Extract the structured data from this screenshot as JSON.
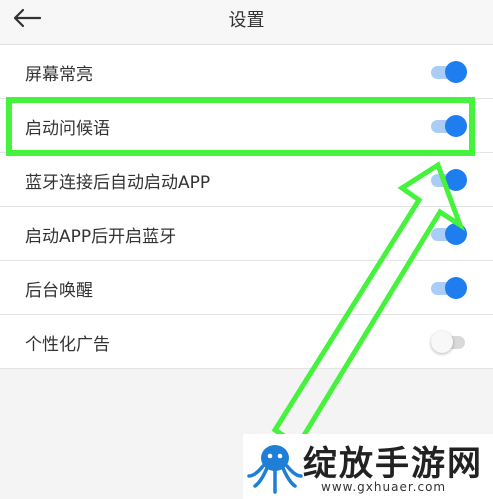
{
  "header": {
    "title": "设置",
    "back_icon": "arrow-left-icon"
  },
  "settings": [
    {
      "label": "屏幕常亮",
      "enabled": true
    },
    {
      "label": "启动问候语",
      "enabled": true
    },
    {
      "label": "蓝牙连接后自动启动APP",
      "enabled": true
    },
    {
      "label": "启动APP后开启蓝牙",
      "enabled": true
    },
    {
      "label": "后台唤醒",
      "enabled": true
    },
    {
      "label": "个性化广告",
      "enabled": false
    }
  ],
  "colors": {
    "toggle_on": "#1e7ef0",
    "toggle_on_track": "#a9cdf6",
    "highlight": "#45f23c"
  },
  "watermark": {
    "name": "绽放手游网",
    "url": "www.gxhuaer.com"
  }
}
